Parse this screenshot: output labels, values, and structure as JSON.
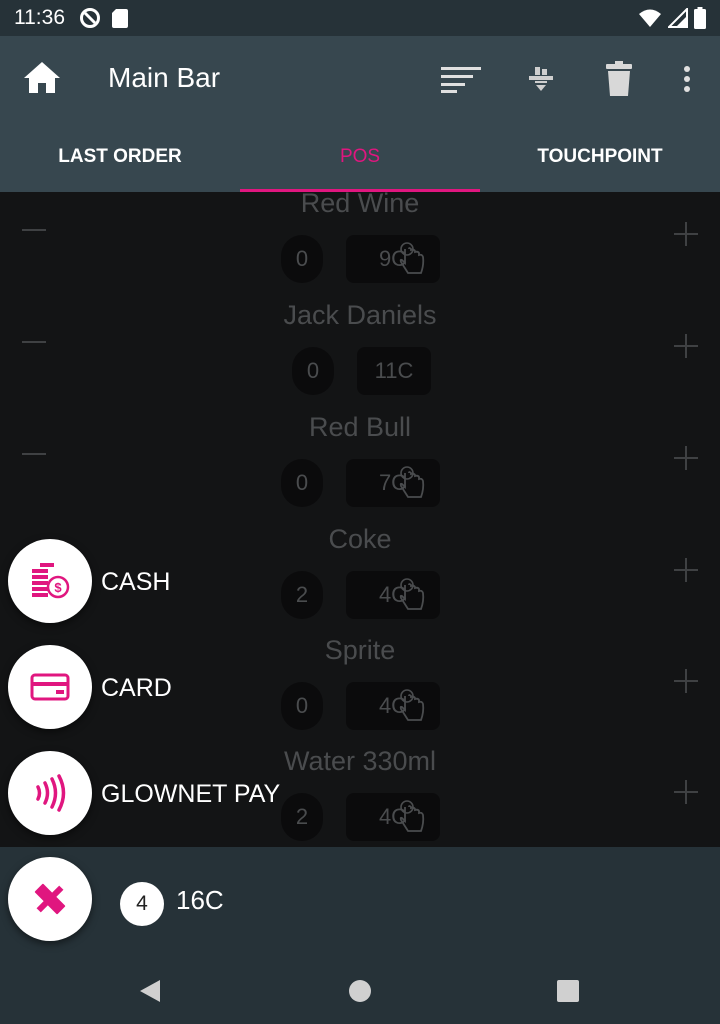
{
  "status_bar": {
    "time": "11:36",
    "icons": [
      "do-not-disturb-icon",
      "sd-card-icon",
      "wifi-icon",
      "cell-signal-icon",
      "battery-icon"
    ]
  },
  "app_bar": {
    "title": "Main Bar",
    "actions": [
      "sort-icon",
      "filter-icon",
      "trash-icon",
      "more-vert-icon"
    ]
  },
  "tabs": [
    {
      "label": "LAST ORDER",
      "active": false
    },
    {
      "label": "POS",
      "active": true
    },
    {
      "label": "TOUCHPOINT",
      "active": false
    }
  ],
  "products": [
    {
      "name": "Red Wine",
      "qty": "0",
      "price": "9C",
      "touch": true
    },
    {
      "name": "Jack Daniels",
      "qty": "0",
      "price": "11C",
      "touch": false
    },
    {
      "name": "Red Bull",
      "qty": "0",
      "price": "7C",
      "touch": true
    },
    {
      "name": "Coke",
      "qty": "2",
      "price": "4C",
      "touch": true
    },
    {
      "name": "Sprite",
      "qty": "0",
      "price": "4C",
      "touch": true
    },
    {
      "name": "Water 330ml",
      "qty": "2",
      "price": "4C",
      "touch": true
    }
  ],
  "payment_options": [
    {
      "label": "CASH",
      "icon": "cash-coins-icon"
    },
    {
      "label": "CARD",
      "icon": "credit-card-icon"
    },
    {
      "label": "GLOWNET PAY",
      "icon": "contactless-icon"
    }
  ],
  "summary": {
    "item_count": "4",
    "total": "16C",
    "fab_icon": "close-x-icon"
  },
  "colors": {
    "accent": "#e0167f",
    "app_bar": "#37474f",
    "status_bar": "#263238",
    "overlay_bg": "#131415"
  },
  "nav": [
    "back-icon",
    "home-circle-icon",
    "recents-icon"
  ]
}
